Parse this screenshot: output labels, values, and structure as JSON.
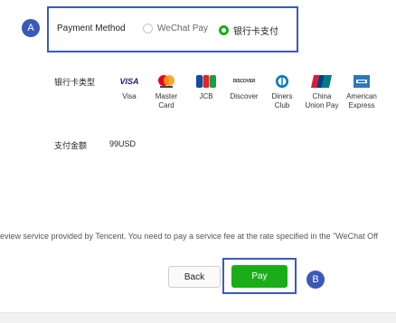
{
  "markers": {
    "a": "A",
    "b": "B"
  },
  "payment_method": {
    "label": "Payment Method",
    "options": [
      {
        "label": "WeChat Pay",
        "selected": false
      },
      {
        "label": "银行卡支付",
        "selected": true
      }
    ]
  },
  "card_types": {
    "label": "银行卡类型",
    "brands": [
      {
        "name": "Visa",
        "logo_text": "VISA",
        "icon": "visa-icon"
      },
      {
        "name": "Master Card",
        "icon": "mastercard-icon"
      },
      {
        "name": "JCB",
        "logo_text": "JCB",
        "icon": "jcb-icon"
      },
      {
        "name": "Discover",
        "logo_text": "DISCOVER",
        "icon": "discover-icon"
      },
      {
        "name": "Diners Club",
        "icon": "diners-club-icon"
      },
      {
        "name": "China Union Pay",
        "icon": "unionpay-icon"
      },
      {
        "name": "American Express",
        "icon": "amex-icon"
      }
    ]
  },
  "amount": {
    "label": "支付金额",
    "value": "99USD"
  },
  "notice": "eview service provided by Tencent. You need to pay a service fee at the rate specified in the \"WeChat Off",
  "buttons": {
    "back": "Back",
    "pay": "Pay"
  },
  "colors": {
    "accent_green": "#1aad19",
    "highlight_blue": "#3c5bb8",
    "marker_blue": "#3b59b5"
  }
}
